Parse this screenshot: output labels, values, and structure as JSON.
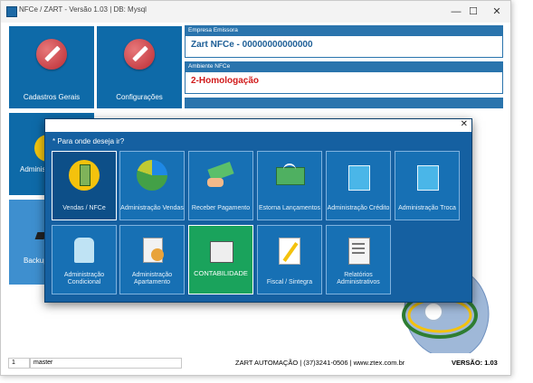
{
  "window": {
    "title": "NFCe / ZART - Versão 1.03  |  DB: Mysql",
    "minimize_glyph": "—",
    "maximize_glyph": "☐",
    "close_glyph": "✕"
  },
  "tiles": [
    {
      "label": "Cadastros Gerais",
      "icon": "pencil-icon"
    },
    {
      "label": "Configurações",
      "icon": "pencil-icon"
    },
    {
      "label": "Administ",
      "icon": "coin-icon"
    },
    {
      "label": "Backup",
      "icon": "disk-icon"
    }
  ],
  "info": {
    "empresa_header": "Empresa Emissora",
    "empresa_value": "Zart NFCe - 00000000000000",
    "ambiente_header": "Ambiente NFCe",
    "ambiente_value": "2-Homologação",
    "accent": "#2a74ad",
    "ambiente_color": "#d11b1b"
  },
  "dialog": {
    "close_glyph": "✕",
    "question": "* Para onde deseja ir?",
    "buttons": [
      {
        "label": "Vendas / NFCe",
        "icon": "calculator-icon"
      },
      {
        "label": "Administração Vendas",
        "icon": "pie-chart-icon"
      },
      {
        "label": "Receber Pagamento",
        "icon": "money-hand-icon"
      },
      {
        "label": "Estorna Lançamentos",
        "icon": "cash-refund-icon"
      },
      {
        "label": "Administração Crédito",
        "icon": "shopping-bag-icon"
      },
      {
        "label": "Administração Troca",
        "icon": "shopping-bag-icon"
      },
      {
        "label": "Administração Condicional",
        "icon": "jacket-icon"
      },
      {
        "label": "Administração Apartamento",
        "icon": "clipboard-user-icon"
      },
      {
        "label": "CONTABILIDADE",
        "icon": "register-icon",
        "highlight": "#1aa35c"
      },
      {
        "label": "Fiscal / Sintegra",
        "icon": "document-pen-icon"
      },
      {
        "label": "Relatórios Administrativos",
        "icon": "report-icon"
      }
    ]
  },
  "status": {
    "user_id": "1",
    "user_name": "master",
    "company": "ZART AUTOMAÇÃO | (37)3241-0506 | www.ztex.com.br",
    "version": "VERSÃO: 1.03"
  }
}
